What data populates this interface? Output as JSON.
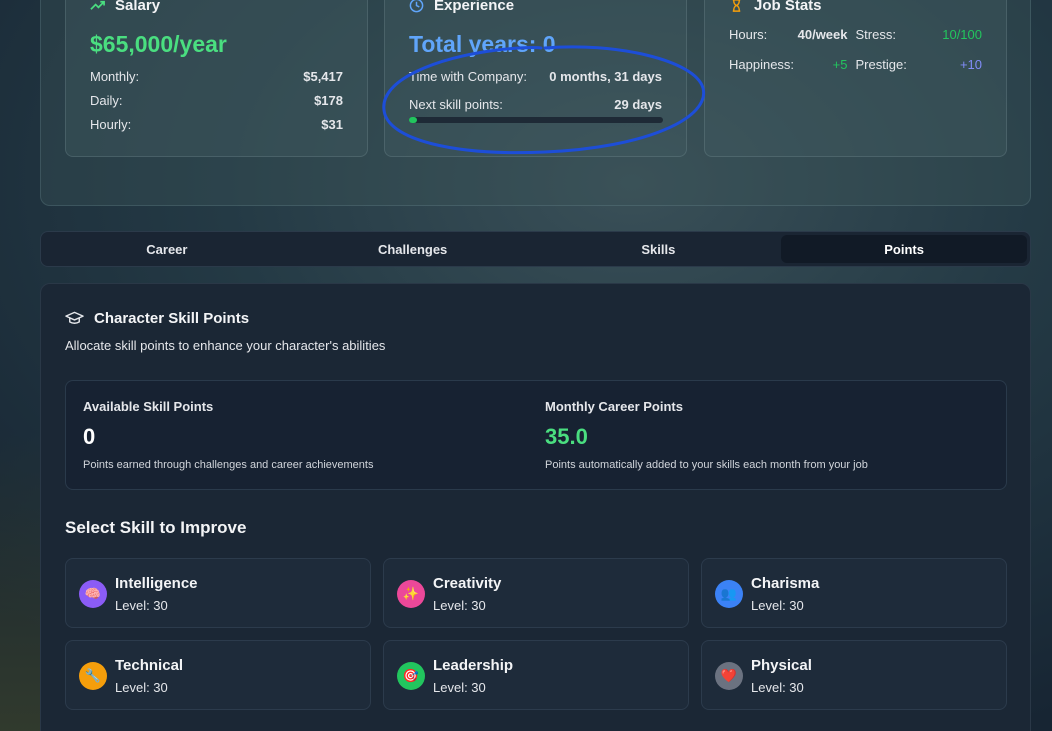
{
  "top": {
    "salary": {
      "title": "Salary",
      "amount": "$65,000/year",
      "rows": [
        {
          "label": "Monthly:",
          "value": "$5,417"
        },
        {
          "label": "Daily:",
          "value": "$178"
        },
        {
          "label": "Hourly:",
          "value": "$31"
        }
      ]
    },
    "experience": {
      "title": "Experience",
      "total": "Total years: 0",
      "company_label": "Time with Company:",
      "company_value": "0 months, 31 days",
      "next_label": "Next skill points:",
      "next_value": "29 days",
      "progress_fraction": 0.03
    },
    "job": {
      "title": "Job Stats",
      "hours_label": "Hours:",
      "hours_value": "40/week",
      "stress_label": "Stress:",
      "stress_value": "10/100",
      "happiness_label": "Happiness:",
      "happiness_value": "+5",
      "prestige_label": "Prestige:",
      "prestige_value": "+10"
    }
  },
  "tabs": [
    {
      "label": "Career"
    },
    {
      "label": "Challenges"
    },
    {
      "label": "Skills"
    },
    {
      "label": "Points",
      "active": true
    }
  ],
  "points": {
    "title": "Character Skill Points",
    "subtitle": "Allocate skill points to enhance your character's abilities",
    "available_label": "Available Skill Points",
    "available_value": "0",
    "available_desc": "Points earned through challenges and career achievements",
    "monthly_label": "Monthly Career Points",
    "monthly_value": "35.0",
    "monthly_desc": "Points automatically added to your skills each month from your job"
  },
  "skills_section": {
    "title": "Select Skill to Improve",
    "skills": [
      {
        "name": "Intelligence",
        "level": "Level: 30",
        "icon": "brain-icon",
        "color": "#8b5cf6"
      },
      {
        "name": "Creativity",
        "level": "Level: 30",
        "icon": "sparkles-icon",
        "color": "#ec4899"
      },
      {
        "name": "Charisma",
        "level": "Level: 30",
        "icon": "people-icon",
        "color": "#3b82f6"
      },
      {
        "name": "Technical",
        "level": "Level: 30",
        "icon": "wrench-icon",
        "color": "#f59e0b"
      },
      {
        "name": "Leadership",
        "level": "Level: 30",
        "icon": "target-icon",
        "color": "#22c55e"
      },
      {
        "name": "Physical",
        "level": "Level: 30",
        "icon": "heart-icon",
        "color": "#6b7280"
      }
    ]
  },
  "colors": {
    "green": "#4ade80",
    "blue": "#60a5fa",
    "prestige": "#818cf8",
    "annotation": "#1d4ed8"
  }
}
